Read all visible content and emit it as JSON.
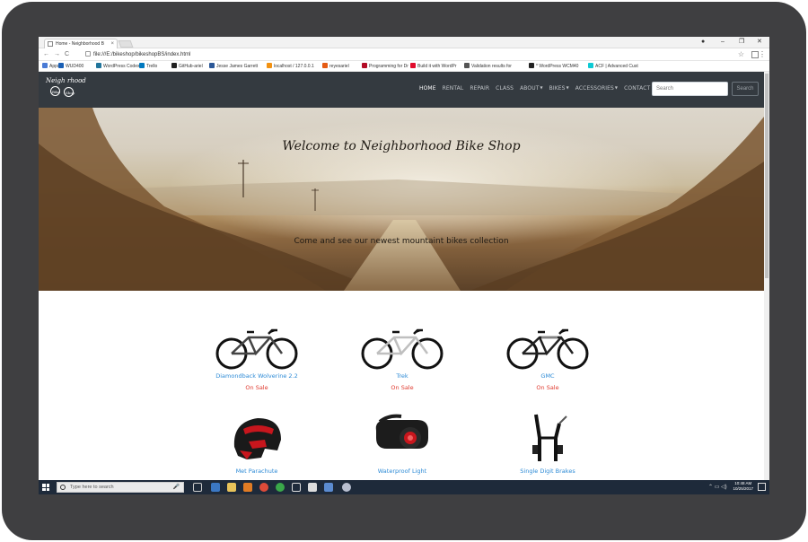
{
  "browser": {
    "tab_title": "Home - Neighborhood B",
    "url": "file:///E:/bikeshop/bikeshopBS/index.html",
    "window_controls": [
      "–",
      "❐",
      "✕"
    ],
    "nav_back": "←",
    "nav_forward": "→",
    "nav_reload": "C",
    "star": "☆",
    "menu": "⋮",
    "bookmarks": [
      {
        "label": "Apps",
        "color": "#4a7bd5"
      },
      {
        "label": "WUD400",
        "color": "#1a5fb4"
      },
      {
        "label": "WordPress Codex",
        "color": "#21759b"
      },
      {
        "label": "Trello",
        "color": "#0079bf"
      },
      {
        "label": "GitHub-ariel",
        "color": "#222222"
      },
      {
        "label": "Jesse James Garrett",
        "color": "#2b5797"
      },
      {
        "label": "localhost / 127.0.0.1",
        "color": "#f29111"
      },
      {
        "label": "reyesariel",
        "color": "#e55b13"
      },
      {
        "label": "Programming for Dr",
        "color": "#b30b25"
      },
      {
        "label": "Build it with WordPr",
        "color": "#e00b2b"
      },
      {
        "label": "Validation results for",
        "color": "#555555"
      },
      {
        "label": "* WordPress WCM40",
        "color": "#222222"
      },
      {
        "label": "ACF | Advanced Cust",
        "color": "#0ecad4"
      }
    ]
  },
  "site": {
    "logo": {
      "word1": "Neigh",
      "word2": "rhood",
      "circle1": "Bike",
      "circle2": "Shop"
    },
    "nav": {
      "items": [
        {
          "label": "HOME",
          "active": true,
          "caret": false
        },
        {
          "label": "RENTAL",
          "active": false,
          "caret": false
        },
        {
          "label": "REPAIR",
          "active": false,
          "caret": false
        },
        {
          "label": "CLASS",
          "active": false,
          "caret": false
        },
        {
          "label": "ABOUT",
          "active": false,
          "caret": true
        },
        {
          "label": "BIKES",
          "active": false,
          "caret": true
        },
        {
          "label": "ACCESSORIES",
          "active": false,
          "caret": true
        },
        {
          "label": "CONTACT",
          "active": false,
          "caret": false
        }
      ],
      "search_placeholder": "Search",
      "search_button": "Search"
    },
    "hero": {
      "title": "Welcome to Neighborhood Bike Shop",
      "subtitle": "Come and see our newest mountaint bikes collection"
    },
    "products": [
      {
        "name": "Diamondback Wolverine 2.2",
        "status": "On Sale",
        "icon": "mountain-bike"
      },
      {
        "name": "Trek",
        "status": "On Sale",
        "icon": "mountain-bike"
      },
      {
        "name": "GMC",
        "status": "On Sale",
        "icon": "mountain-bike"
      },
      {
        "name": "Met Parachute",
        "status": "",
        "icon": "helmet"
      },
      {
        "name": "Waterproof Light",
        "status": "",
        "icon": "bike-light"
      },
      {
        "name": "Single Digit Brakes",
        "status": "",
        "icon": "brakes"
      }
    ]
  },
  "taskbar": {
    "search_placeholder": "Type here to search",
    "time": "10:48 AM",
    "date": "10/25/2017",
    "tray": "⌃ ▭ ◁)"
  },
  "colors": {
    "navbar": "#343a40",
    "link": "#2e8bd6",
    "sale": "#e03a2f",
    "bezel": "#3f3f41",
    "taskbar": "#1e2a3a"
  }
}
